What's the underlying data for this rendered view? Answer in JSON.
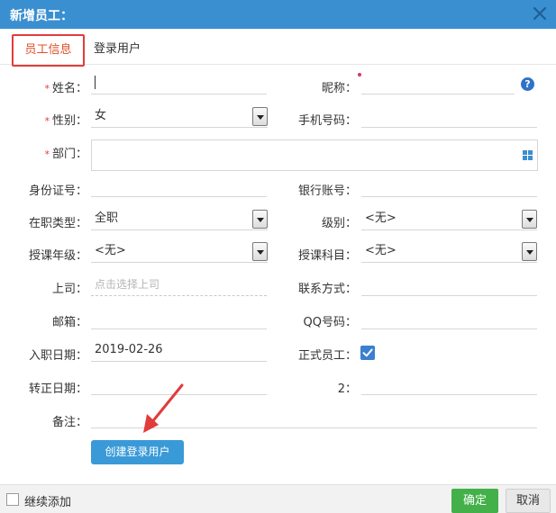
{
  "dialog": {
    "title": "新增员工："
  },
  "tabs": [
    {
      "label": "员工信息"
    },
    {
      "label": "登录用户"
    }
  ],
  "form": {
    "name": {
      "label": "姓名：",
      "value": ""
    },
    "nickname": {
      "label": "昵称：",
      "value": ""
    },
    "gender": {
      "label": "性别：",
      "value": "女"
    },
    "phone": {
      "label": "手机号码：",
      "value": ""
    },
    "dept": {
      "label": "部门：",
      "value": ""
    },
    "id_number": {
      "label": "身份证号：",
      "value": ""
    },
    "bank_account": {
      "label": "银行账号：",
      "value": ""
    },
    "job_type": {
      "label": "在职类型：",
      "value": "全职"
    },
    "level": {
      "label": "级别：",
      "value": "<无>"
    },
    "teach_grade": {
      "label": "授课年级：",
      "value": "<无>"
    },
    "teach_subject": {
      "label": "授课科目：",
      "value": "<无>"
    },
    "supervisor": {
      "label": "上司：",
      "placeholder": "点击选择上司"
    },
    "contact": {
      "label": "联系方式：",
      "value": ""
    },
    "email": {
      "label": "邮箱：",
      "value": ""
    },
    "qq": {
      "label": "QQ号码：",
      "value": ""
    },
    "join_date": {
      "label": "入职日期：",
      "value": "2019-02-26"
    },
    "formal": {
      "label": "正式员工：",
      "checked": true
    },
    "regular_date": {
      "label": "转正日期：",
      "value": ""
    },
    "field2": {
      "label": "2：",
      "value": ""
    },
    "remark": {
      "label": "备注：",
      "value": ""
    }
  },
  "required_mark": "*",
  "help_glyph": "?",
  "create_login_button": "创建登录用户",
  "footer": {
    "continue_add": "继续添加",
    "confirm": "确定",
    "cancel": "取消"
  }
}
